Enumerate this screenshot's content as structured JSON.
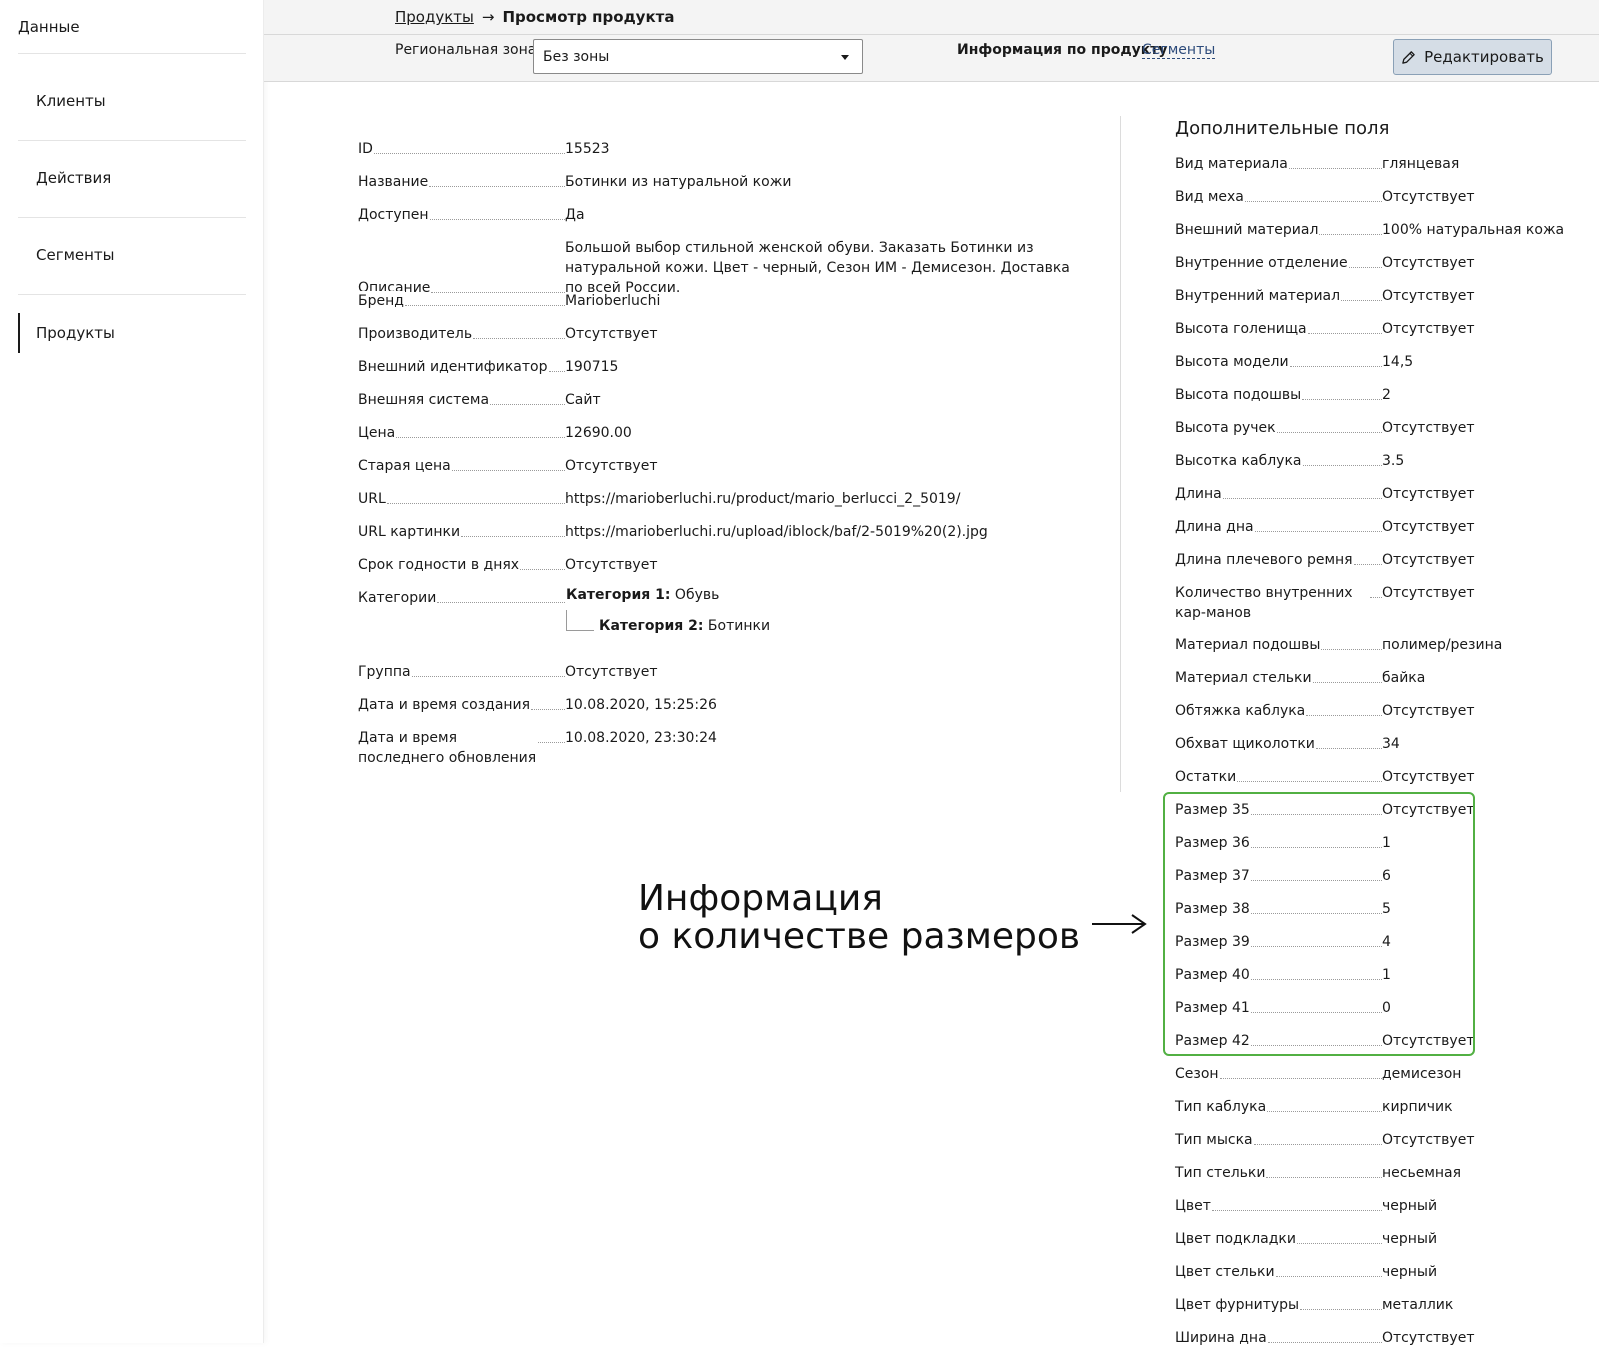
{
  "sidebar": {
    "title": "Данные",
    "items": [
      {
        "label": "Клиенты",
        "active": false
      },
      {
        "label": "Действия",
        "active": false
      },
      {
        "label": "Сегменты",
        "active": false
      },
      {
        "label": "Продукты",
        "active": true
      }
    ]
  },
  "header": {
    "breadcrumb_link": "Продукты",
    "breadcrumb_separator": "→",
    "breadcrumb_current": "Просмотр продукта",
    "zone_label": "Региональная зона",
    "zone_value": "Без зоны",
    "tab_info": "Информация по продукту",
    "tab_segments": "Сегменты",
    "edit_label": "Редактировать"
  },
  "product": [
    {
      "label": "ID",
      "value": "15523"
    },
    {
      "label": "Название",
      "value": "Ботинки из натуральной кожи"
    },
    {
      "label": "Доступен",
      "value": "Да"
    },
    {
      "label": "Описание",
      "value": "Большой выбор стильной женской обуви. Заказать Ботинки из натуральной кожи. Цвет - черный, Сезон ИМ - Демисезон. Доставка по всей России."
    },
    {
      "label": "Бренд",
      "value": "Marioberluchi"
    },
    {
      "label": "Производитель",
      "value": "Отсутствует"
    },
    {
      "label": "Внешний идентификатор",
      "value": "190715"
    },
    {
      "label": "Внешняя система",
      "value": "Сайт"
    },
    {
      "label": "Цена",
      "value": "12690.00"
    },
    {
      "label": "Старая цена",
      "value": "Отсутствует"
    },
    {
      "label": "URL",
      "value": "https://marioberluchi.ru/product/mario_berlucci_2_5019/"
    },
    {
      "label": "URL картинки",
      "value": "https://marioberluchi.ru/upload/iblock/baf/2-5019%20(2).jpg"
    },
    {
      "label": "Срок годности в днях",
      "value": "Отсутствует"
    },
    {
      "label": "Категории",
      "value": ""
    },
    {
      "label": "Группа",
      "value": "Отсутствует"
    },
    {
      "label": "Дата и время создания",
      "value": "10.08.2020, 15:25:26"
    },
    {
      "label": "Дата и время последнего обновления",
      "value": "10.08.2020, 23:30:24"
    }
  ],
  "categories": {
    "cat1_label": "Категория 1:",
    "cat1_value": "Обувь",
    "cat2_label": "Категория 2:",
    "cat2_value": "Ботинки"
  },
  "extra": {
    "title": "Дополнительные поля",
    "fields": [
      {
        "label": "Вид материала",
        "value": "глянцевая"
      },
      {
        "label": "Вид меха",
        "value": "Отсутствует"
      },
      {
        "label": "Внешний материал",
        "value": "100% натуральная кожа"
      },
      {
        "label": "Внутренние отделение",
        "value": "Отсутствует"
      },
      {
        "label": "Внутренний материал",
        "value": "Отсутствует"
      },
      {
        "label": "Высота голенища",
        "value": "Отсутствует"
      },
      {
        "label": "Высота модели",
        "value": "14,5"
      },
      {
        "label": "Высота подошвы",
        "value": "2"
      },
      {
        "label": "Высота ручек",
        "value": "Отсутствует"
      },
      {
        "label": "Высотка каблука",
        "value": "3.5"
      },
      {
        "label": "Длина",
        "value": "Отсутствует"
      },
      {
        "label": "Длина дна",
        "value": "Отсутствует"
      },
      {
        "label": "Длина плечевого ремня",
        "value": "Отсутствует"
      },
      {
        "label": "Количество внутренних кар-манов",
        "value": "Отсутствует"
      },
      {
        "label": "Материал подошвы",
        "value": "полимер/резина"
      },
      {
        "label": "Материал стельки",
        "value": "байка"
      },
      {
        "label": "Обтяжка каблука",
        "value": "Отсутствует"
      },
      {
        "label": "Обхват щиколотки",
        "value": "34"
      },
      {
        "label": "Остатки",
        "value": "Отсутствует"
      },
      {
        "label": "Размер 35",
        "value": "Отсутствует"
      },
      {
        "label": "Размер 36",
        "value": "1"
      },
      {
        "label": "Размер 37",
        "value": "6"
      },
      {
        "label": "Размер 38",
        "value": "5"
      },
      {
        "label": "Размер 39",
        "value": "4"
      },
      {
        "label": "Размер 40",
        "value": "1"
      },
      {
        "label": "Размер 41",
        "value": "0"
      },
      {
        "label": "Размер 42",
        "value": "Отсутствует"
      },
      {
        "label": "Сезон",
        "value": "демисезон"
      },
      {
        "label": "Тип каблука",
        "value": "кирпичик"
      },
      {
        "label": "Тип мыска",
        "value": "Отсутствует"
      },
      {
        "label": "Тип стельки",
        "value": "несьемная"
      },
      {
        "label": "Цвет",
        "value": "черный"
      },
      {
        "label": "Цвет подкладки",
        "value": "черный"
      },
      {
        "label": "Цвет стельки",
        "value": "черный"
      },
      {
        "label": "Цвет фурнитуры",
        "value": "металлик"
      },
      {
        "label": "Ширина дна",
        "value": "Отсутствует"
      }
    ]
  },
  "annotation": {
    "line1": "Информация",
    "line2": "о количестве размеров"
  },
  "colors": {
    "highlight_border": "#52b043",
    "edit_button_bg": "#d5dde6",
    "link": "#2c4a7a"
  },
  "icons": {
    "edit": "pencil-icon",
    "select": "chevron-down-icon",
    "annotation": "arrow-right-icon"
  }
}
